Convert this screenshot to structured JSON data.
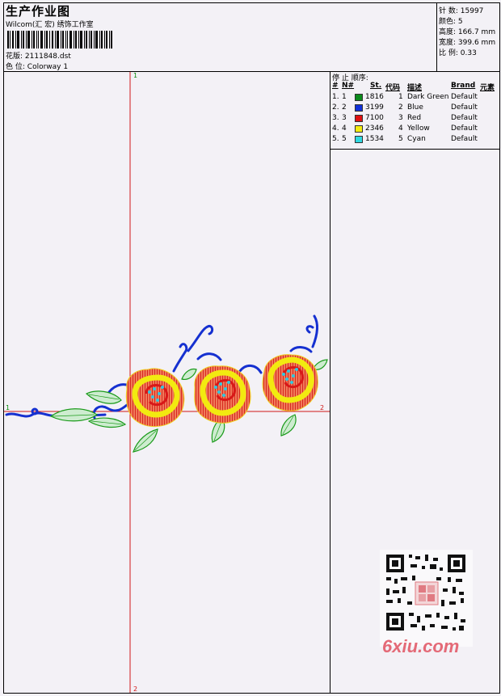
{
  "header": {
    "title": "生产作业图",
    "studio": "Wilcom(汇 宏) 绣饰工作室",
    "design_file_label": "花版:",
    "design_file": "2111848.dst",
    "colorway_label": "色 位:",
    "colorway": "Colorway 1"
  },
  "stats": [
    {
      "label": "针 数:",
      "value": "15997"
    },
    {
      "label": "颜色:",
      "value": "5"
    },
    {
      "label": "高度:",
      "value": "166.7 mm"
    },
    {
      "label": "宽度:",
      "value": "399.6 mm"
    },
    {
      "label": "比 例:",
      "value": "0.33"
    }
  ],
  "stop_sequence": {
    "title": "停 止 顺序:",
    "columns": [
      "#",
      "N#",
      "St.",
      "代码",
      "描述",
      "Brand",
      "元素"
    ],
    "rows": [
      {
        "index": "1.",
        "needle": "1",
        "color": "#0b8a1c",
        "stitches": "1816",
        "code": "1",
        "desc": "Dark Green",
        "brand": "Default"
      },
      {
        "index": "2.",
        "needle": "2",
        "color": "#1030d8",
        "stitches": "3199",
        "code": "2",
        "desc": "Blue",
        "brand": "Default"
      },
      {
        "index": "3.",
        "needle": "3",
        "color": "#e01010",
        "stitches": "7100",
        "code": "3",
        "desc": "Red",
        "brand": "Default"
      },
      {
        "index": "4.",
        "needle": "4",
        "color": "#f4ec10",
        "stitches": "2346",
        "code": "4",
        "desc": "Yellow",
        "brand": "Default"
      },
      {
        "index": "5.",
        "needle": "5",
        "color": "#30d8e0",
        "stitches": "1534",
        "code": "5",
        "desc": "Cyan",
        "brand": "Default"
      }
    ]
  },
  "axis_labels": {
    "v_top": "1",
    "v_bottom": "2",
    "h_left": "1",
    "h_right": "2"
  },
  "watermark": "6xiu.com",
  "colors": {
    "axis": "#d01818",
    "leaf": "#1a9a1a",
    "leaf_fill": "#cdeccf",
    "stem": "#1530d0",
    "rose_outer": "#e85a45",
    "rose_yellow": "#f2ea10",
    "rose_core": "#d81818",
    "dots": "#30c8e0"
  }
}
